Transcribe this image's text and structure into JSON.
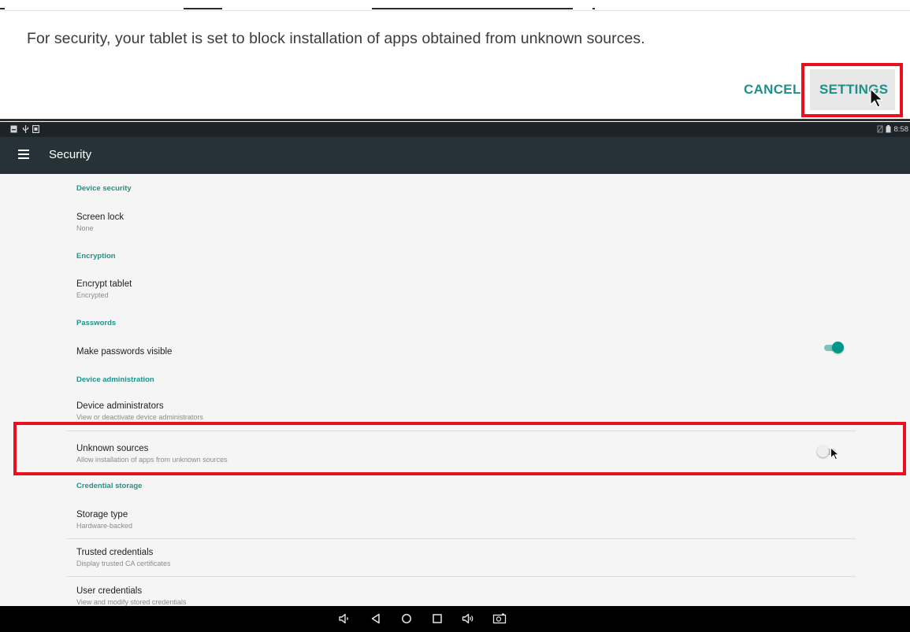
{
  "dialog": {
    "message": "For security, your tablet is set to block installation of apps obtained from unknown sources.",
    "cancel_label": "CANCEL",
    "settings_label": "SETTINGS"
  },
  "status_bar": {
    "time": "8:58",
    "left_icons": [
      "notification-icon",
      "usb-icon",
      "screenshot-icon"
    ],
    "right_icons": [
      "no-sim-icon",
      "battery-icon"
    ]
  },
  "app_bar": {
    "title": "Security",
    "menu_icon": "hamburger-menu-icon"
  },
  "sections": [
    {
      "header": "Device security",
      "items": [
        {
          "title": "Screen lock",
          "subtitle": "None"
        }
      ]
    },
    {
      "header": "Encryption",
      "items": [
        {
          "title": "Encrypt tablet",
          "subtitle": "Encrypted"
        }
      ]
    },
    {
      "header": "Passwords",
      "items": [
        {
          "title": "Make passwords visible",
          "toggle": true
        }
      ]
    },
    {
      "header": "Device administration",
      "items": [
        {
          "title": "Device administrators",
          "subtitle": "View or deactivate device administrators"
        },
        {
          "title": "Unknown sources",
          "subtitle": "Allow installation of apps from unknown sources",
          "toggle": false
        }
      ]
    },
    {
      "header": "Credential storage",
      "items": [
        {
          "title": "Storage type",
          "subtitle": "Hardware-backed"
        },
        {
          "title": "Trusted credentials",
          "subtitle": "Display trusted CA certificates"
        },
        {
          "title": "User credentials",
          "subtitle": "View and modify stored credentials"
        }
      ]
    }
  ],
  "nav_bar": {
    "icons": [
      "volume-down-icon",
      "back-icon",
      "home-icon",
      "recents-icon",
      "volume-up-icon",
      "screenshot-button-icon"
    ]
  },
  "colors": {
    "accent": "#1f938a",
    "highlight": "#e8101c",
    "app_bar": "#263238",
    "status_bar": "#1d2327"
  }
}
